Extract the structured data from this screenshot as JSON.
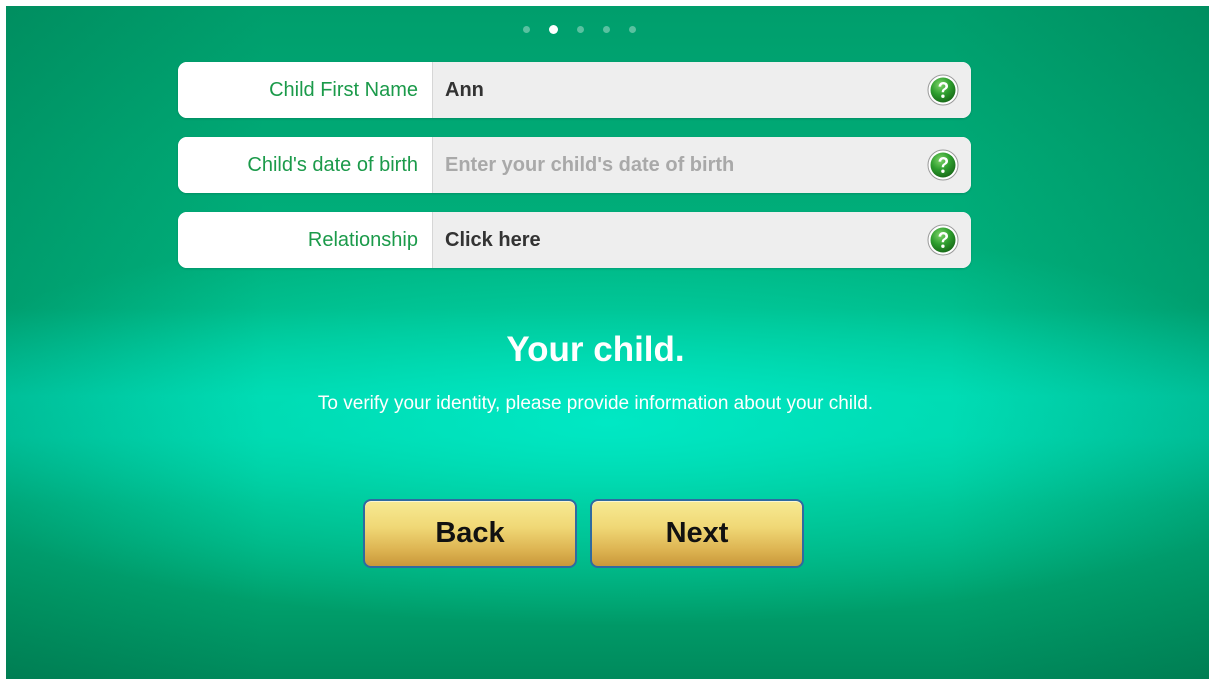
{
  "pager": {
    "total": 5,
    "active_index": 1
  },
  "form": {
    "fields": [
      {
        "label": "Child First Name",
        "value": "Ann",
        "placeholder": ""
      },
      {
        "label": "Child's date of birth",
        "value": "",
        "placeholder": "Enter your child's date of birth"
      },
      {
        "label": "Relationship",
        "value": "Click here",
        "placeholder": ""
      }
    ],
    "help_icon": "question-mark-circle-icon"
  },
  "content": {
    "heading": "Your child.",
    "subtext": "To verify your identity, please provide information about your child."
  },
  "buttons": {
    "back_label": "Back",
    "next_label": "Next"
  },
  "colors": {
    "background_green": "#00a874",
    "label_green": "#1b9a4a",
    "button_gold": "#e7c862",
    "button_border": "#2f6aa0",
    "help_icon_green": "#2e9e2e"
  }
}
